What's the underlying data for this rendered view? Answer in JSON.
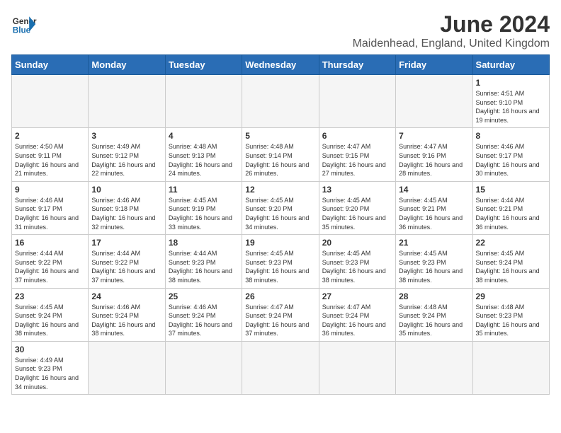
{
  "header": {
    "logo_text_general": "General",
    "logo_text_blue": "Blue",
    "title": "June 2024",
    "subtitle": "Maidenhead, England, United Kingdom"
  },
  "days_of_week": [
    "Sunday",
    "Monday",
    "Tuesday",
    "Wednesday",
    "Thursday",
    "Friday",
    "Saturday"
  ],
  "weeks": [
    [
      {
        "day": null
      },
      {
        "day": null
      },
      {
        "day": null
      },
      {
        "day": null
      },
      {
        "day": null
      },
      {
        "day": null
      },
      {
        "day": 1,
        "sunrise": "4:51 AM",
        "sunset": "9:10 PM",
        "daylight": "16 hours and 19 minutes."
      }
    ],
    [
      {
        "day": 2,
        "sunrise": "4:50 AM",
        "sunset": "9:11 PM",
        "daylight": "16 hours and 21 minutes."
      },
      {
        "day": 3,
        "sunrise": "4:49 AM",
        "sunset": "9:12 PM",
        "daylight": "16 hours and 22 minutes."
      },
      {
        "day": 4,
        "sunrise": "4:48 AM",
        "sunset": "9:13 PM",
        "daylight": "16 hours and 24 minutes."
      },
      {
        "day": 5,
        "sunrise": "4:48 AM",
        "sunset": "9:14 PM",
        "daylight": "16 hours and 26 minutes."
      },
      {
        "day": 6,
        "sunrise": "4:47 AM",
        "sunset": "9:15 PM",
        "daylight": "16 hours and 27 minutes."
      },
      {
        "day": 7,
        "sunrise": "4:47 AM",
        "sunset": "9:16 PM",
        "daylight": "16 hours and 28 minutes."
      },
      {
        "day": 8,
        "sunrise": "4:46 AM",
        "sunset": "9:17 PM",
        "daylight": "16 hours and 30 minutes."
      }
    ],
    [
      {
        "day": 9,
        "sunrise": "4:46 AM",
        "sunset": "9:17 PM",
        "daylight": "16 hours and 31 minutes."
      },
      {
        "day": 10,
        "sunrise": "4:46 AM",
        "sunset": "9:18 PM",
        "daylight": "16 hours and 32 minutes."
      },
      {
        "day": 11,
        "sunrise": "4:45 AM",
        "sunset": "9:19 PM",
        "daylight": "16 hours and 33 minutes."
      },
      {
        "day": 12,
        "sunrise": "4:45 AM",
        "sunset": "9:20 PM",
        "daylight": "16 hours and 34 minutes."
      },
      {
        "day": 13,
        "sunrise": "4:45 AM",
        "sunset": "9:20 PM",
        "daylight": "16 hours and 35 minutes."
      },
      {
        "day": 14,
        "sunrise": "4:45 AM",
        "sunset": "9:21 PM",
        "daylight": "16 hours and 36 minutes."
      },
      {
        "day": 15,
        "sunrise": "4:44 AM",
        "sunset": "9:21 PM",
        "daylight": "16 hours and 36 minutes."
      }
    ],
    [
      {
        "day": 16,
        "sunrise": "4:44 AM",
        "sunset": "9:22 PM",
        "daylight": "16 hours and 37 minutes."
      },
      {
        "day": 17,
        "sunrise": "4:44 AM",
        "sunset": "9:22 PM",
        "daylight": "16 hours and 37 minutes."
      },
      {
        "day": 18,
        "sunrise": "4:44 AM",
        "sunset": "9:23 PM",
        "daylight": "16 hours and 38 minutes."
      },
      {
        "day": 19,
        "sunrise": "4:45 AM",
        "sunset": "9:23 PM",
        "daylight": "16 hours and 38 minutes."
      },
      {
        "day": 20,
        "sunrise": "4:45 AM",
        "sunset": "9:23 PM",
        "daylight": "16 hours and 38 minutes."
      },
      {
        "day": 21,
        "sunrise": "4:45 AM",
        "sunset": "9:23 PM",
        "daylight": "16 hours and 38 minutes."
      },
      {
        "day": 22,
        "sunrise": "4:45 AM",
        "sunset": "9:24 PM",
        "daylight": "16 hours and 38 minutes."
      }
    ],
    [
      {
        "day": 23,
        "sunrise": "4:45 AM",
        "sunset": "9:24 PM",
        "daylight": "16 hours and 38 minutes."
      },
      {
        "day": 24,
        "sunrise": "4:46 AM",
        "sunset": "9:24 PM",
        "daylight": "16 hours and 38 minutes."
      },
      {
        "day": 25,
        "sunrise": "4:46 AM",
        "sunset": "9:24 PM",
        "daylight": "16 hours and 37 minutes."
      },
      {
        "day": 26,
        "sunrise": "4:47 AM",
        "sunset": "9:24 PM",
        "daylight": "16 hours and 37 minutes."
      },
      {
        "day": 27,
        "sunrise": "4:47 AM",
        "sunset": "9:24 PM",
        "daylight": "16 hours and 36 minutes."
      },
      {
        "day": 28,
        "sunrise": "4:48 AM",
        "sunset": "9:24 PM",
        "daylight": "16 hours and 35 minutes."
      },
      {
        "day": 29,
        "sunrise": "4:48 AM",
        "sunset": "9:23 PM",
        "daylight": "16 hours and 35 minutes."
      }
    ],
    [
      {
        "day": 30,
        "sunrise": "4:49 AM",
        "sunset": "9:23 PM",
        "daylight": "16 hours and 34 minutes."
      },
      {
        "day": null
      },
      {
        "day": null
      },
      {
        "day": null
      },
      {
        "day": null
      },
      {
        "day": null
      },
      {
        "day": null
      }
    ]
  ]
}
